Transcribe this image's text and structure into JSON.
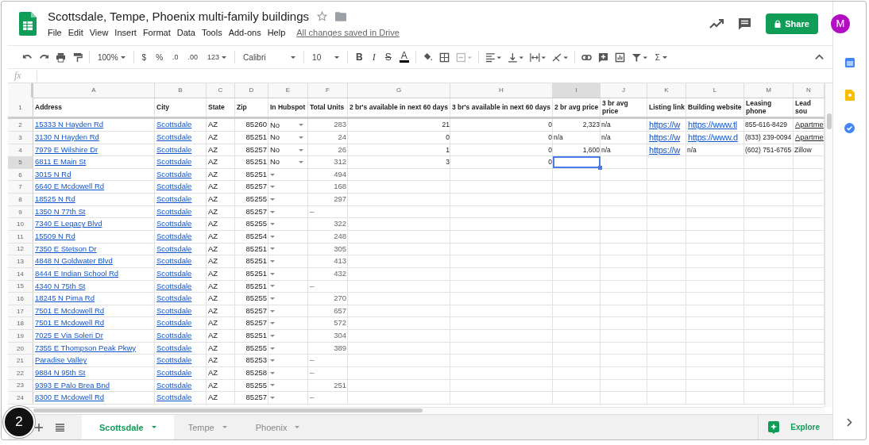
{
  "document": {
    "title": "Scottsdale, Tempe, Phoenix multi-family buildings",
    "save_status": "All changes saved in Drive"
  },
  "menu": [
    "File",
    "Edit",
    "View",
    "Insert",
    "Format",
    "Data",
    "Tools",
    "Add-ons",
    "Help"
  ],
  "share": "Share",
  "avatar": "M",
  "toolbar": {
    "zoom": "100%",
    "currency": "$",
    "percent": "%",
    "decimal_less": ".0",
    "decimal_more": ".00",
    "number_format": "123",
    "font": "Calibri",
    "font_size": "10",
    "bold": "B",
    "italic": "I",
    "strikethrough": "S",
    "text_color": "A",
    "functions": "Σ"
  },
  "formula_bar": {
    "label": "fx"
  },
  "columns": [
    {
      "letter": "A",
      "selected": false
    },
    {
      "letter": "B",
      "selected": false
    },
    {
      "letter": "C",
      "selected": false
    },
    {
      "letter": "D",
      "selected": false
    },
    {
      "letter": "E",
      "selected": false
    },
    {
      "letter": "F",
      "selected": false
    },
    {
      "letter": "G",
      "selected": false
    },
    {
      "letter": "H",
      "selected": false
    },
    {
      "letter": "I",
      "selected": true
    },
    {
      "letter": "J",
      "selected": false
    },
    {
      "letter": "K",
      "selected": false
    },
    {
      "letter": "L",
      "selected": false
    },
    {
      "letter": "M",
      "selected": false
    },
    {
      "letter": "N",
      "selected": false
    }
  ],
  "header_row": {
    "num": "1",
    "cells": [
      "Address",
      "City",
      "State",
      "Zip",
      "In Hubspot",
      "Total Units",
      "2 br's available in next 60 days",
      "3 br's available in next 60 days",
      "2 br avg price",
      "3 br avg price",
      "Listing link",
      "Building website",
      "Leasing phone",
      "Lead sou"
    ]
  },
  "rows": [
    {
      "num": "2",
      "selected": false,
      "address": "15333 N Hayden Rd",
      "city": "Scottsdale",
      "state": "AZ",
      "zip": "85260",
      "hubspot": "No",
      "units": {
        "kind": "number",
        "text": "283"
      },
      "extra": [
        {
          "kind": "number",
          "text": "21"
        },
        {
          "kind": "number",
          "text": "0"
        },
        {
          "kind": "number",
          "text": "2,323"
        },
        {
          "kind": "text",
          "text": "n/a"
        },
        {
          "kind": "link",
          "text": "https://w"
        },
        {
          "kind": "link",
          "text": "https://www.tl"
        },
        {
          "kind": "text",
          "text": "855-616-8429"
        },
        {
          "kind": "source",
          "text": "Apartme"
        }
      ]
    },
    {
      "num": "3",
      "selected": false,
      "address": "3130 N Hayden Rd",
      "city": "Scottsdale",
      "state": "AZ",
      "zip": "85251",
      "hubspot": "No",
      "units": {
        "kind": "number",
        "text": "24"
      },
      "extra": [
        {
          "kind": "number",
          "text": "0"
        },
        {
          "kind": "number",
          "text": "0"
        },
        {
          "kind": "text",
          "text": "n/a"
        },
        {
          "kind": "text",
          "text": "n/a"
        },
        {
          "kind": "link",
          "text": "https://w"
        },
        {
          "kind": "link",
          "text": "https://www.d"
        },
        {
          "kind": "text",
          "text": "(833) 239-0094"
        },
        {
          "kind": "source",
          "text": "Apartme"
        }
      ]
    },
    {
      "num": "4",
      "selected": false,
      "address": "7979 E Wilshire Dr",
      "city": "Scottsdale",
      "state": "AZ",
      "zip": "85257",
      "hubspot": "No",
      "units": {
        "kind": "number",
        "text": "26"
      },
      "extra": [
        {
          "kind": "number",
          "text": "1"
        },
        {
          "kind": "number",
          "text": "0"
        },
        {
          "kind": "number",
          "text": "1,600"
        },
        {
          "kind": "text",
          "text": "n/a"
        },
        {
          "kind": "link",
          "text": "https://w"
        },
        {
          "kind": "text",
          "text": "n/a"
        },
        {
          "kind": "text",
          "text": "(602) 751-6765"
        },
        {
          "kind": "text",
          "text": "Zillow"
        }
      ]
    },
    {
      "num": "5",
      "selected": true,
      "address": "6811 E Main St",
      "city": "Scottsdale",
      "state": "AZ",
      "zip": "85251",
      "hubspot": "No",
      "units": {
        "kind": "number",
        "text": "312"
      },
      "extra": [
        {
          "kind": "number",
          "text": "3"
        },
        {
          "kind": "number",
          "text": "0"
        }
      ]
    },
    {
      "num": "6",
      "selected": false,
      "address": "3015 N  Rd",
      "city": "Scottsdale",
      "state": "AZ",
      "zip": "85251",
      "units": {
        "kind": "number",
        "text": "494"
      }
    },
    {
      "num": "7",
      "selected": false,
      "address": "6640 E Mcdowell Rd",
      "city": "Scottsdale",
      "state": "AZ",
      "zip": "85257",
      "units": {
        "kind": "number",
        "text": "168"
      }
    },
    {
      "num": "8",
      "selected": false,
      "address": "18525 N  Rd",
      "city": "Scottsdale",
      "state": "AZ",
      "zip": "85255",
      "units": {
        "kind": "number",
        "text": "297"
      }
    },
    {
      "num": "9",
      "selected": false,
      "address": "1350 N 77th St",
      "city": "Scottsdale",
      "state": "AZ",
      "zip": "85257",
      "units": {
        "kind": "text",
        "text": "–"
      }
    },
    {
      "num": "10",
      "selected": false,
      "address": "7340 E Legacy Blvd",
      "city": "Scottsdale",
      "state": "AZ",
      "zip": "85255",
      "units": {
        "kind": "number",
        "text": "322"
      }
    },
    {
      "num": "11",
      "selected": false,
      "address": "15509 N  Rd",
      "city": "Scottsdale",
      "state": "AZ",
      "zip": "85254",
      "units": {
        "kind": "number",
        "text": "248"
      }
    },
    {
      "num": "12",
      "selected": false,
      "address": "7350 E Stetson Dr",
      "city": "Scottsdale",
      "state": "AZ",
      "zip": "85251",
      "units": {
        "kind": "number",
        "text": "305"
      }
    },
    {
      "num": "13",
      "selected": false,
      "address": "4848 N Goldwater Blvd",
      "city": "Scottsdale",
      "state": "AZ",
      "zip": "85251",
      "units": {
        "kind": "number",
        "text": "413"
      }
    },
    {
      "num": "14",
      "selected": false,
      "address": "8444 E Indian School Rd",
      "city": "Scottsdale",
      "state": "AZ",
      "zip": "85251",
      "units": {
        "kind": "number",
        "text": "432"
      }
    },
    {
      "num": "15",
      "selected": false,
      "address": "4340 N 75th St",
      "city": "Scottsdale",
      "state": "AZ",
      "zip": "85251",
      "units": {
        "kind": "text",
        "text": "–"
      }
    },
    {
      "num": "16",
      "selected": false,
      "address": "18245 N Pima Rd",
      "city": "Scottsdale",
      "state": "AZ",
      "zip": "85255",
      "units": {
        "kind": "number",
        "text": "270"
      }
    },
    {
      "num": "17",
      "selected": false,
      "address": "7501 E Mcdowell Rd",
      "city": "Scottsdale",
      "state": "AZ",
      "zip": "85257",
      "units": {
        "kind": "number",
        "text": "657"
      }
    },
    {
      "num": "18",
      "selected": false,
      "address": "7501 E Mcdowell Rd",
      "city": "Scottsdale",
      "state": "AZ",
      "zip": "85257",
      "units": {
        "kind": "number",
        "text": "572"
      }
    },
    {
      "num": "19",
      "selected": false,
      "address": "7025 E Via Soleri Dr",
      "city": "Scottsdale",
      "state": "AZ",
      "zip": "85251",
      "units": {
        "kind": "number",
        "text": "304"
      }
    },
    {
      "num": "20",
      "selected": false,
      "address": "7355 E Thompson Peak Pkwy",
      "city": "Scottsdale",
      "state": "AZ",
      "zip": "85255",
      "units": {
        "kind": "number",
        "text": "389"
      }
    },
    {
      "num": "21",
      "selected": false,
      "address": "Paradise Valley",
      "city": "Scottsdale",
      "state": "AZ",
      "zip": "85253",
      "units": {
        "kind": "text",
        "text": "–"
      }
    },
    {
      "num": "22",
      "selected": false,
      "address": "9884 N 95th St",
      "city": "Scottsdale",
      "state": "AZ",
      "zip": "85258",
      "units": {
        "kind": "text",
        "text": "–"
      }
    },
    {
      "num": "23",
      "selected": false,
      "address": "9393 E Palo Brea Bnd",
      "city": "Scottsdale",
      "state": "AZ",
      "zip": "85255",
      "units": {
        "kind": "number",
        "text": "251"
      }
    },
    {
      "num": "24",
      "selected": false,
      "address": "8300 E Mcdowell Rd",
      "city": "Scottsdale",
      "state": "AZ",
      "zip": "85257",
      "units": {
        "kind": "text",
        "text": "–"
      }
    }
  ],
  "sheet_tabs": [
    {
      "label": "Scottsdale",
      "selected": true
    },
    {
      "label": "Tempe",
      "selected": false
    },
    {
      "label": "Phoenix",
      "selected": false
    }
  ],
  "explore": "Explore",
  "callout": "2"
}
